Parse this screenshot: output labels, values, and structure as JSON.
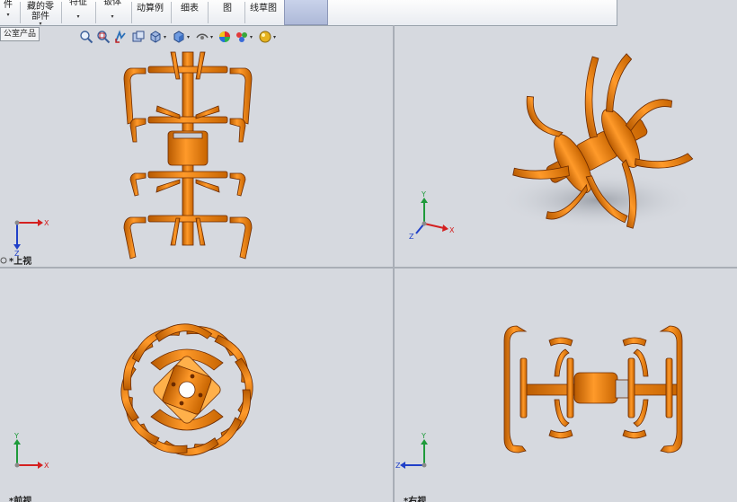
{
  "ribbon": {
    "buttons": [
      {
        "name": "ribbon-btn-part",
        "line1": "",
        "line2": "件",
        "caret": "▾"
      },
      {
        "name": "ribbon-btn-hidden-parts",
        "line1": "藏的零",
        "line2": "部件",
        "caret": "▾"
      },
      {
        "name": "ribbon-btn-feature",
        "line1": "特征",
        "line2": "",
        "caret": "▾"
      },
      {
        "name": "ribbon-btn-sheetmetal",
        "line1": "钣体",
        "line2": "",
        "caret": "▾"
      },
      {
        "name": "ribbon-btn-motion-study",
        "line1": "动算例",
        "line2": "",
        "caret": ""
      },
      {
        "name": "ribbon-btn-bom",
        "line1": "细表",
        "line2": "",
        "caret": ""
      },
      {
        "name": "ribbon-btn-drawing",
        "line1": "图",
        "line2": "",
        "caret": ""
      },
      {
        "name": "ribbon-btn-sketch",
        "line1": "线草图",
        "line2": "",
        "caret": ""
      }
    ]
  },
  "tree": {
    "label": "公室产品"
  },
  "viewports": {
    "top": {
      "label": "*上视"
    },
    "front": {
      "label": "*前视"
    },
    "right": {
      "label": "*右视"
    }
  },
  "triad": {
    "x": "X",
    "y": "Y",
    "z": "Z"
  },
  "colors": {
    "part": "#f08a1e",
    "edge": "#6b2a00",
    "axis_x": "#d42020",
    "axis_y": "#1e9a3a",
    "axis_z": "#2040c8"
  },
  "icons": [
    "zoom-fit-icon",
    "zoom-area-icon",
    "previous-view-icon",
    "section-view-icon",
    "view-orientation-icon",
    "display-style-icon",
    "hide-show-icon",
    "edit-appearance-icon",
    "apply-scene-icon",
    "view-settings-icon"
  ]
}
